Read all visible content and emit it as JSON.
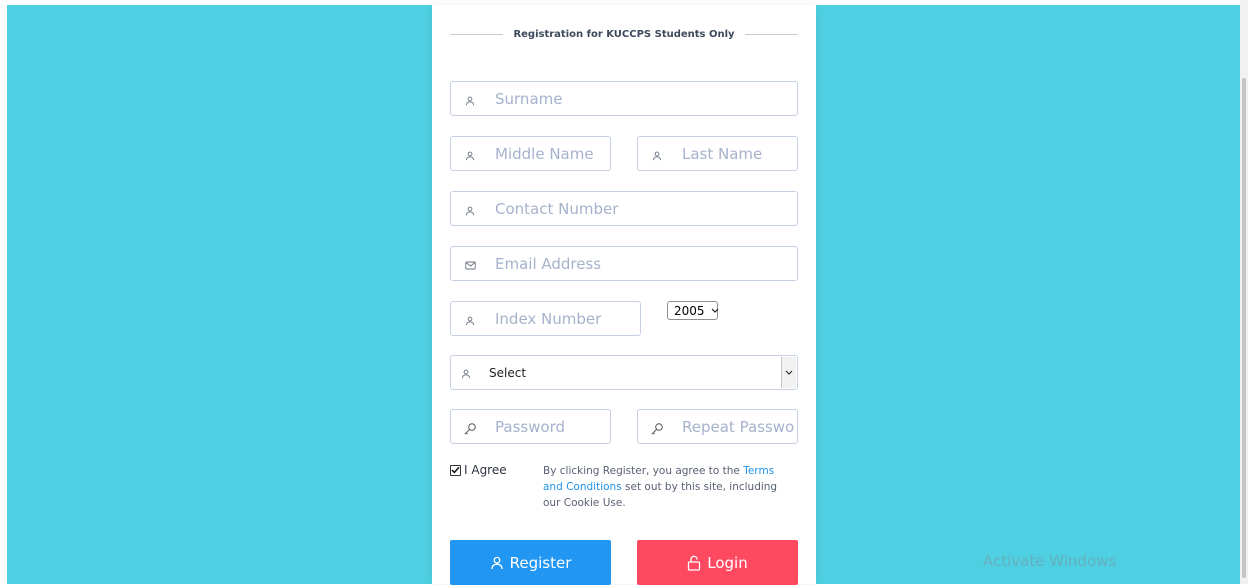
{
  "form": {
    "heading": "Registration for KUCCPS Students Only",
    "surname_placeholder": "Surname",
    "middle_name_placeholder": "Middle Name",
    "last_name_placeholder": "Last Name",
    "contact_placeholder": "Contact Number",
    "email_placeholder": "Email Address",
    "index_placeholder": "Index Number",
    "year_selected": "2005",
    "select_value": "Select",
    "password_placeholder": "Password",
    "repeat_password_placeholder": "Repeat Password",
    "agree_label": "I Agree",
    "agree_checked": true,
    "terms_prefix": "By clicking Register, you agree to the ",
    "terms_link": "Terms and Conditions",
    "terms_suffix": " set out by this site, including our Cookie Use.",
    "register_label": "Register",
    "login_label": "Login"
  },
  "colors": {
    "background": "#4fd0e2",
    "register_button": "#2196f3",
    "login_button": "#ff4961",
    "link": "#1f93e8"
  },
  "watermark": "Activate Windows"
}
